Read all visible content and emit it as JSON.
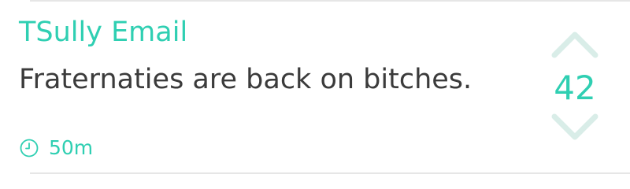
{
  "post": {
    "author": "TSully Email",
    "message": "Fraternaties are back on bitches.",
    "time": "50m",
    "score": "42",
    "icons": {
      "clock": "clock-icon",
      "upvote": "chevron-up-icon",
      "downvote": "chevron-down-icon"
    }
  },
  "colors": {
    "accent": "#2fcfb2",
    "text": "#3b3b3b",
    "vote_inactive": "#d9ede8",
    "divider": "#e6e6e6"
  }
}
